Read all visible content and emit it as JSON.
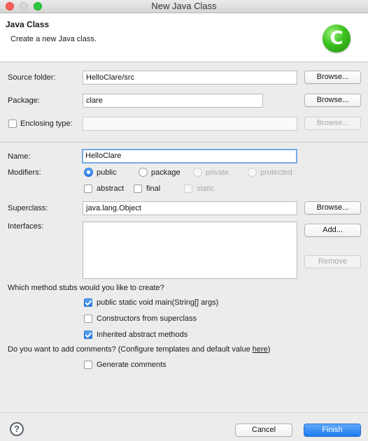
{
  "window": {
    "title": "New Java Class"
  },
  "header": {
    "title": "Java Class",
    "description": "Create a new Java class."
  },
  "form": {
    "source_folder": {
      "label": "Source folder:",
      "value": "HelloClare/src",
      "browse": "Browse..."
    },
    "package": {
      "label": "Package:",
      "value": "clare",
      "browse": "Browse..."
    },
    "enclosing_type": {
      "label": "Enclosing type:",
      "value": "",
      "browse": "Browse...",
      "checked": false
    },
    "name": {
      "label": "Name:",
      "value": "HelloClare"
    },
    "modifiers": {
      "label": "Modifiers:",
      "access": [
        "public",
        "package",
        "private",
        "protected"
      ],
      "selected": "public",
      "abstract": "abstract",
      "final": "final",
      "static": "static"
    },
    "superclass": {
      "label": "Superclass:",
      "value": "java.lang.Object",
      "browse": "Browse..."
    },
    "interfaces": {
      "label": "Interfaces:",
      "add": "Add...",
      "remove": "Remove"
    },
    "stubs": {
      "question": "Which method stubs would you like to create?",
      "main": {
        "label": "public static void main(String[] args)",
        "checked": true
      },
      "constructors": {
        "label": "Constructors from superclass",
        "checked": false
      },
      "inherited": {
        "label": "Inherited abstract methods",
        "checked": true
      }
    },
    "comments": {
      "question_prefix": "Do you want to add comments? (Configure templates and default value ",
      "link": "here",
      "question_suffix": ")",
      "generate": {
        "label": "Generate comments",
        "checked": false
      }
    }
  },
  "footer": {
    "cancel": "Cancel",
    "finish": "Finish",
    "help_glyph": "?"
  },
  "colors": {
    "accent": "#2a7fe8",
    "logo": "#3cc21f"
  },
  "icons": {
    "logo": "class-c-icon",
    "help": "help-icon"
  }
}
